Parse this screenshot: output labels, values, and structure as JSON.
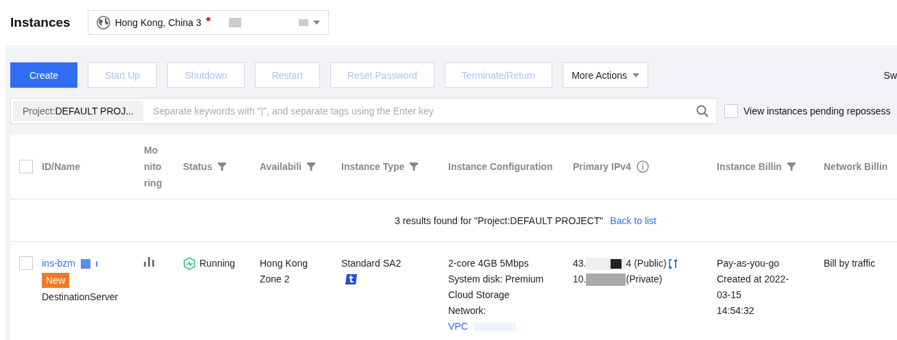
{
  "page_title": "Instances",
  "region_selector": {
    "value": "Hong Kong, China 3",
    "alert": true
  },
  "toolbar": {
    "buttons": [
      {
        "label": "Create",
        "kind": "primary",
        "disabled": false
      },
      {
        "label": "Start Up",
        "kind": "plain",
        "disabled": true
      },
      {
        "label": "Shutdown",
        "kind": "plain",
        "disabled": true
      },
      {
        "label": "Restart",
        "kind": "plain",
        "disabled": true
      },
      {
        "label": "Reset Password",
        "kind": "plain",
        "disabled": true
      },
      {
        "label": "Terminate/Return",
        "kind": "plain",
        "disabled": true
      },
      {
        "label": "More Actions",
        "kind": "menu",
        "disabled": false
      }
    ],
    "right_label": "Sw"
  },
  "search": {
    "tag_key": "Project:",
    "tag_value": "DEFAULT PROJ...",
    "placeholder": "Separate keywords with \"|\", and separate tags using the Enter key",
    "pending_option": {
      "label": "View instances pending repossess",
      "checked": false
    }
  },
  "table": {
    "select_all": {
      "checked": false
    },
    "columns": [
      {
        "label": "ID/Name",
        "filter": false,
        "info": false,
        "kind": "text"
      },
      {
        "label": "Mo nito ring",
        "filter": false,
        "info": false,
        "kind": "narrow"
      },
      {
        "label": "Status",
        "filter": true,
        "info": false,
        "kind": "text"
      },
      {
        "label": "Availabili",
        "filter": true,
        "info": false,
        "kind": "text"
      },
      {
        "label": "Instance Type",
        "filter": true,
        "info": false,
        "kind": "text"
      },
      {
        "label": "Instance Configuration",
        "filter": false,
        "info": false,
        "kind": "text"
      },
      {
        "label": "Primary IPv4",
        "filter": false,
        "info": true,
        "kind": "text"
      },
      {
        "label": "Instance Billin",
        "filter": true,
        "info": false,
        "kind": "text"
      },
      {
        "label": "Network Billin",
        "filter": false,
        "info": false,
        "kind": "text"
      }
    ],
    "notice": {
      "text": "3 results found for \"Project:DEFAULT PROJECT\"",
      "link": "Back to list"
    },
    "rows": [
      {
        "selected": false,
        "id": "ins-bzm",
        "badge": "New",
        "name": "DestinationServer",
        "status": "Running",
        "zone": "Hong Kong Zone 2",
        "instance_type": "Standard SA2",
        "config": [
          "2-core 4GB 5Mbps",
          "System disk: Premium Cloud Storage",
          "Network:"
        ],
        "network_link": "VPC",
        "ips": [
          {
            "prefix": "43.",
            "suffix": "4 (Public)"
          },
          {
            "prefix": "10.",
            "suffix": "(Private)"
          }
        ],
        "billing": [
          "Pay-as-you-go",
          "Created at 2022-",
          "03-15",
          "14:54:32"
        ],
        "network_billing": "Bill by traffic"
      }
    ]
  }
}
